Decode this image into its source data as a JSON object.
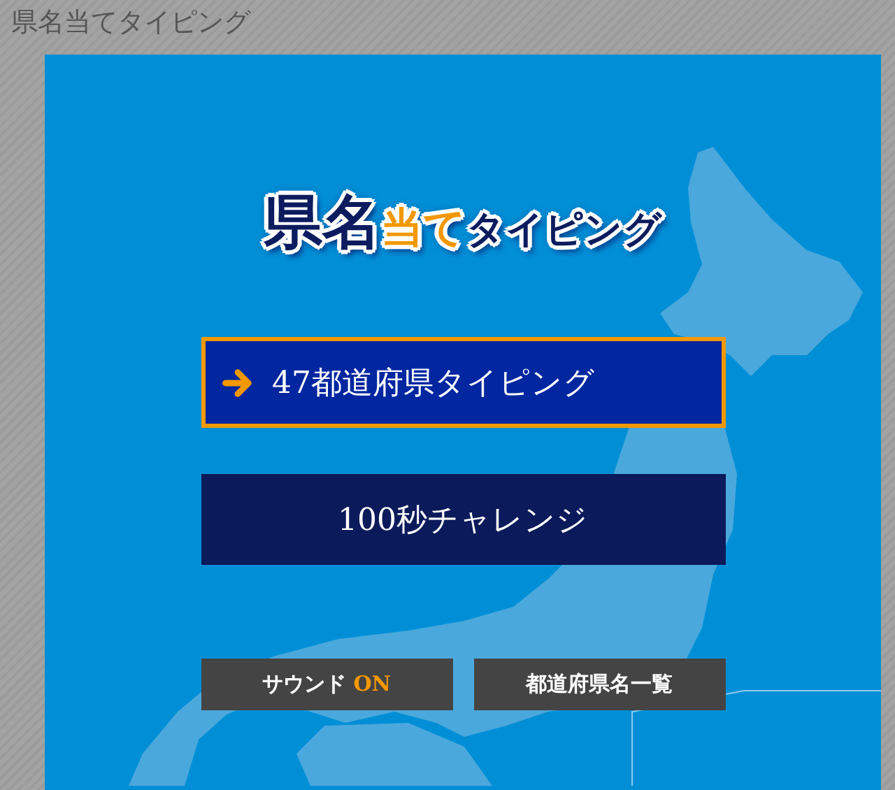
{
  "page_title": "県名当てタイピング",
  "logo": [
    {
      "text": "県名",
      "kind": "main"
    },
    {
      "text": "当て",
      "kind": "accent"
    },
    {
      "text": "タイピング",
      "kind": "sub"
    }
  ],
  "menu": [
    {
      "label": "47都道府県タイピング",
      "selected": true
    },
    {
      "label": "100秒チャレンジ",
      "selected": false
    }
  ],
  "sound_button": {
    "label": "サウンド",
    "state": "ON"
  },
  "list_button": {
    "label": "都道府県名一覧"
  }
}
